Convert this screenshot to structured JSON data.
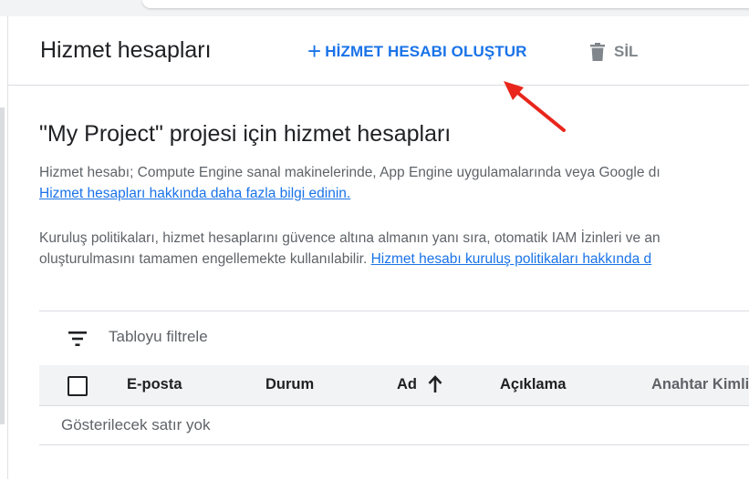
{
  "header": {
    "title": "Hizmet hesapları",
    "create_label": "HİZMET HESABI OLUŞTUR",
    "delete_label": "SİL"
  },
  "intro": {
    "title": "\"My Project\" projesi için hizmet hesapları",
    "para1_text": "Hizmet hesabı; Compute Engine sanal makinelerinde, App Engine uygulamalarında veya Google dı",
    "para1_link": "Hizmet hesapları hakkında daha fazla bilgi edinin.",
    "para2_line1": "Kuruluş politikaları, hizmet hesaplarını güvence altına almanın yanı sıra, otomatik IAM İzinleri ve an",
    "para2_line2": "oluşturulmasını tamamen engellemekte kullanılabilir.",
    "para2_link": "Hizmet hesabı kuruluş politikaları hakkında d"
  },
  "table": {
    "filter_label": "Tabloyu filtrele",
    "columns": {
      "email": "E-posta",
      "status": "Durum",
      "name": "Ad",
      "description": "Açıklama",
      "key_id": "Anahtar Kimli"
    },
    "sort": {
      "column": "name",
      "direction": "ascending",
      "icon": "arrow-upward-icon"
    },
    "empty_message": "Gösterilecek satır yok"
  },
  "icons": {
    "create": "plus-icon",
    "delete": "trash-icon",
    "filter": "filter-list-icon"
  },
  "colors": {
    "primary_link": "#1a73e8",
    "disabled": "#80868b",
    "annotation_arrow": "#e8261c",
    "header_bg": "#f1f3f4"
  }
}
